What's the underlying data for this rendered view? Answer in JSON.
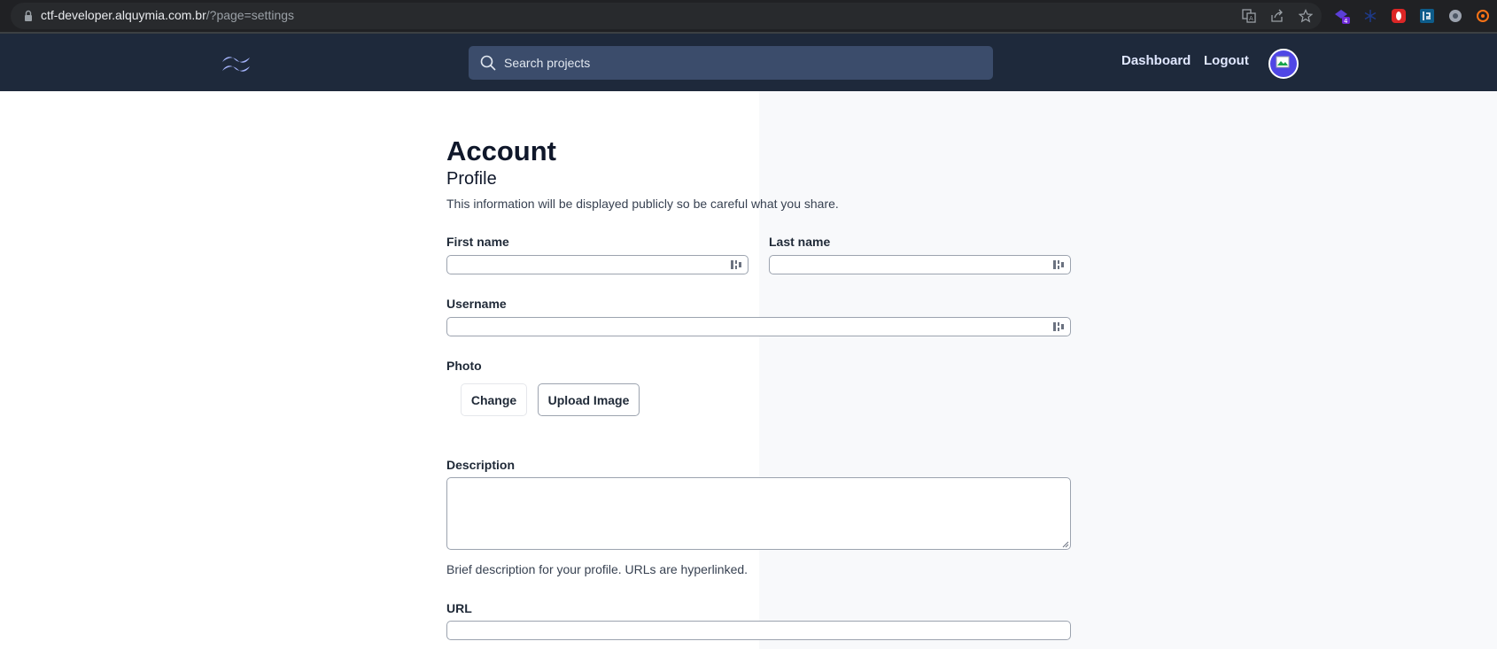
{
  "browser": {
    "url_host": "ctf-developer.alquymia.com.br",
    "url_path": "/?page=settings",
    "extension_badge": "4"
  },
  "navbar": {
    "search_placeholder": "Search projects",
    "links": [
      {
        "label": "Dashboard"
      },
      {
        "label": "Logout"
      }
    ]
  },
  "page": {
    "title": "Account",
    "section_title": "Profile",
    "section_hint": "This information will be displayed publicly so be careful what you share."
  },
  "form": {
    "first_name_label": "First name",
    "first_name_value": "",
    "last_name_label": "Last name",
    "last_name_value": "",
    "username_label": "Username",
    "username_value": "",
    "photo_label": "Photo",
    "change_button": "Change",
    "upload_button": "Upload Image",
    "description_label": "Description",
    "description_value": "",
    "description_hint": "Brief description for your profile. URLs are hyperlinked.",
    "url_label": "URL",
    "url_value": ""
  },
  "colors": {
    "navbar_bg": "#1e293b",
    "search_bg": "#3b4c6b",
    "avatar_bg": "#4f46e5"
  }
}
